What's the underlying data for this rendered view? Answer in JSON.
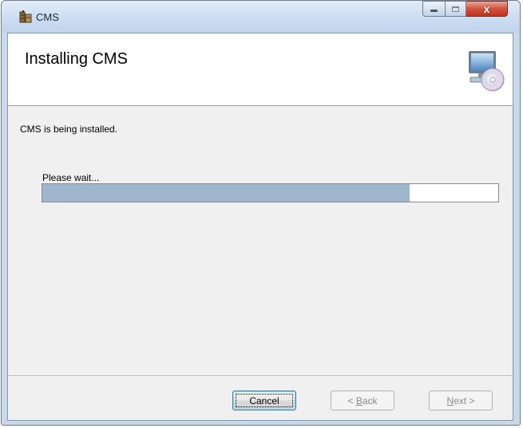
{
  "window": {
    "title": "CMS",
    "controls": {
      "minimize_icon": "minimize-icon",
      "maximize_icon": "maximize-icon",
      "close_glyph": "x"
    }
  },
  "header": {
    "title": "Installing CMS",
    "graphic_icon": "computer-cd-icon"
  },
  "body": {
    "status_text": "CMS is being installed.",
    "wait_label": "Please wait...",
    "progress_fraction": 0.806
  },
  "footer": {
    "cancel": {
      "label": "Cancel",
      "enabled": true,
      "focused": true
    },
    "back": {
      "prefix": "< ",
      "mnemonic": "B",
      "rest": "ack",
      "enabled": false
    },
    "next": {
      "mnemonic": "N",
      "rest": "ext >",
      "enabled": false
    }
  },
  "colors": {
    "progress_fill": "#9eb6d0",
    "close_button": "#c1331b",
    "titlebar": "#cfe0f3"
  }
}
